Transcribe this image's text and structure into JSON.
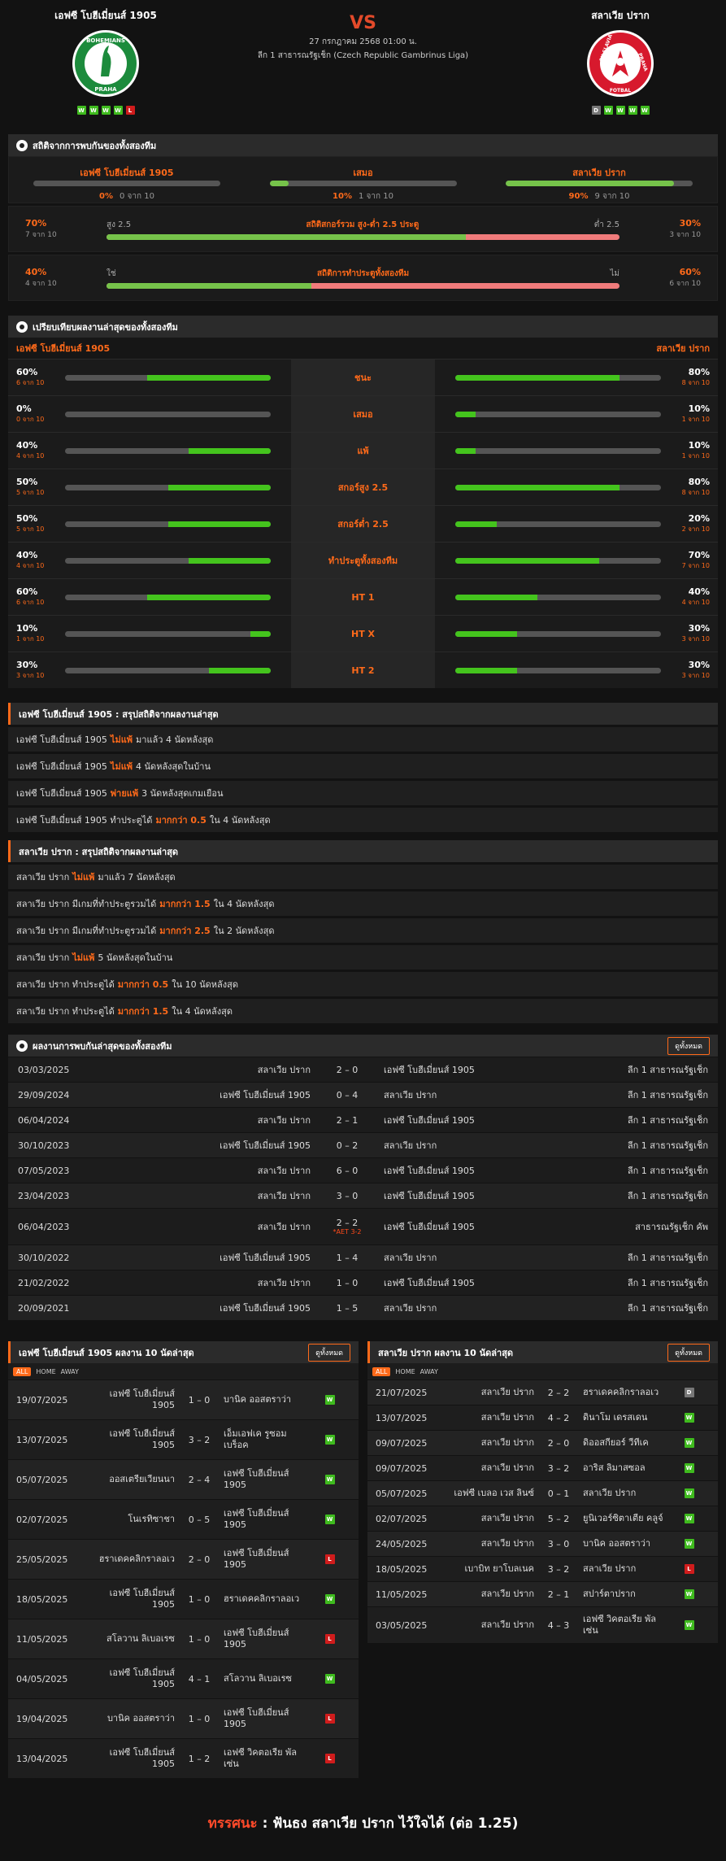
{
  "header": {
    "home": {
      "name": "เอฟซี โบฮีเมี่ยนส์ 1905",
      "form": [
        "W",
        "W",
        "W",
        "W",
        "L"
      ]
    },
    "away": {
      "name": "สลาเวีย ปราก",
      "form": [
        "D",
        "W",
        "W",
        "W",
        "W"
      ]
    },
    "vs": "VS",
    "date": "27 กรกฎาคม 2568 01:00 น.",
    "league": "ลีก 1 สาธารณรัฐเช็ก (Czech Republic Gambrinus Liga)",
    "home_logo_text": [
      "BOHEMIANS",
      "PRAHA"
    ],
    "away_logo_text": [
      "SK SLAVIA",
      "PRAHA",
      "FOTBAL"
    ]
  },
  "h2h_stats": {
    "title": "สถิติจากการพบกันของทั้งสองทีม",
    "cols": [
      {
        "label": "เอฟซี โบฮีเมี่ยนส์ 1905",
        "pct": "0%",
        "of": "0 จาก 10",
        "fill": 0
      },
      {
        "label": "เสมอ",
        "pct": "10%",
        "of": "1 จาก 10",
        "fill": 10
      },
      {
        "label": "สลาเวีย ปราก",
        "pct": "90%",
        "of": "9 จาก 10",
        "fill": 90
      }
    ],
    "ou": {
      "left_pct": "70%",
      "left_of": "7 จาก 10",
      "left_label": "สูง 2.5",
      "title": "สถิติสกอร์รวม สูง-ต่ำ 2.5 ประตู",
      "right_label": "ต่ำ 2.5",
      "right_pct": "30%",
      "right_of": "3 จาก 10",
      "fill": 70
    },
    "btts": {
      "left_pct": "40%",
      "left_of": "4 จาก 10",
      "left_label": "ใช่",
      "title": "สถิติการทำประตูทั้งสองทีม",
      "right_label": "ไม่",
      "right_pct": "60%",
      "right_of": "6 จาก 10",
      "fill": 40
    }
  },
  "compare": {
    "title": "เปรียบเทียบผลงานล่าสุดของทั้งสองทีม",
    "home": "เอฟซี โบฮีเมี่ยนส์ 1905",
    "away": "สลาเวีย ปราก",
    "rows": [
      {
        "label": "ชนะ",
        "hp": "60%",
        "ho": "6 จาก 10",
        "hv": 60,
        "ap": "80%",
        "ao": "8 จาก 10",
        "av": 80
      },
      {
        "label": "เสมอ",
        "hp": "0%",
        "ho": "0 จาก 10",
        "hv": 0,
        "ap": "10%",
        "ao": "1 จาก 10",
        "av": 10
      },
      {
        "label": "แพ้",
        "hp": "40%",
        "ho": "4 จาก 10",
        "hv": 40,
        "ap": "10%",
        "ao": "1 จาก 10",
        "av": 10
      },
      {
        "label": "สกอร์สูง 2.5",
        "hp": "50%",
        "ho": "5 จาก 10",
        "hv": 50,
        "ap": "80%",
        "ao": "8 จาก 10",
        "av": 80
      },
      {
        "label": "สกอร์ต่ำ 2.5",
        "hp": "50%",
        "ho": "5 จาก 10",
        "hv": 50,
        "ap": "20%",
        "ao": "2 จาก 10",
        "av": 20
      },
      {
        "label": "ทำประตูทั้งสองทีม",
        "hp": "40%",
        "ho": "4 จาก 10",
        "hv": 40,
        "ap": "70%",
        "ao": "7 จาก 10",
        "av": 70
      },
      {
        "label": "HT 1",
        "hp": "60%",
        "ho": "6 จาก 10",
        "hv": 60,
        "ap": "40%",
        "ao": "4 จาก 10",
        "av": 40
      },
      {
        "label": "HT X",
        "hp": "10%",
        "ho": "1 จาก 10",
        "hv": 10,
        "ap": "30%",
        "ao": "3 จาก 10",
        "av": 30
      },
      {
        "label": "HT 2",
        "hp": "30%",
        "ho": "3 จาก 10",
        "hv": 30,
        "ap": "30%",
        "ao": "3 จาก 10",
        "av": 30
      }
    ]
  },
  "home_summary": {
    "title": "เอฟซี โบฮีเมี่ยนส์ 1905 : สรุปสถิติจากผลงานล่าสุด",
    "rows": [
      [
        "เอฟซี โบฮีเมี่ยนส์ 1905",
        "ไม่แพ้",
        "มาแล้ว 4 นัดหลังสุด"
      ],
      [
        "เอฟซี โบฮีเมี่ยนส์ 1905",
        "ไม่แพ้",
        "4 นัดหลังสุดในบ้าน"
      ],
      [
        "เอฟซี โบฮีเมี่ยนส์ 1905",
        "พ่ายแพ้",
        "3 นัดหลังสุดเกมเยือน"
      ],
      [
        "เอฟซี โบฮีเมี่ยนส์ 1905 ทำประตูได้",
        "มากกว่า 0.5",
        "ใน 4 นัดหลังสุด"
      ]
    ]
  },
  "away_summary": {
    "title": "สลาเวีย ปราก : สรุปสถิติจากผลงานล่าสุด",
    "rows": [
      [
        "สลาเวีย ปราก",
        "ไม่แพ้",
        "มาแล้ว 7 นัดหลังสุด"
      ],
      [
        "สลาเวีย ปราก มีเกมที่ทำประตูรวมได้",
        "มากกว่า 1.5",
        "ใน 4 นัดหลังสุด"
      ],
      [
        "สลาเวีย ปราก มีเกมที่ทำประตูรวมได้",
        "มากกว่า 2.5",
        "ใน 2 นัดหลังสุด"
      ],
      [
        "สลาเวีย ปราก",
        "ไม่แพ้",
        "5 นัดหลังสุดในบ้าน"
      ],
      [
        "สลาเวีย ปราก ทำประตูได้",
        "มากกว่า 0.5",
        "ใน 10 นัดหลังสุด"
      ],
      [
        "สลาเวีย ปราก ทำประตูได้",
        "มากกว่า 1.5",
        "ใน 4 นัดหลังสุด"
      ]
    ]
  },
  "h2h_list": {
    "title": "ผลงานการพบกันล่าสุดของทั้งสองทีม",
    "button": "ดูทั้งหมด",
    "rows": [
      {
        "d": "03/03/2025",
        "h": "สลาเวีย ปราก",
        "s": "2 – 0",
        "a": "เอฟซี โบฮีเมี่ยนส์ 1905",
        "l": "ลีก 1 สาธารณรัฐเช็ก",
        "n": ""
      },
      {
        "d": "29/09/2024",
        "h": "เอฟซี โบฮีเมี่ยนส์ 1905",
        "s": "0 – 4",
        "a": "สลาเวีย ปราก",
        "l": "ลีก 1 สาธารณรัฐเช็ก",
        "n": ""
      },
      {
        "d": "06/04/2024",
        "h": "สลาเวีย ปราก",
        "s": "2 – 1",
        "a": "เอฟซี โบฮีเมี่ยนส์ 1905",
        "l": "ลีก 1 สาธารณรัฐเช็ก",
        "n": ""
      },
      {
        "d": "30/10/2023",
        "h": "เอฟซี โบฮีเมี่ยนส์ 1905",
        "s": "0 – 2",
        "a": "สลาเวีย ปราก",
        "l": "ลีก 1 สาธารณรัฐเช็ก",
        "n": ""
      },
      {
        "d": "07/05/2023",
        "h": "สลาเวีย ปราก",
        "s": "6 – 0",
        "a": "เอฟซี โบฮีเมี่ยนส์ 1905",
        "l": "ลีก 1 สาธารณรัฐเช็ก",
        "n": ""
      },
      {
        "d": "23/04/2023",
        "h": "สลาเวีย ปราก",
        "s": "3 – 0",
        "a": "เอฟซี โบฮีเมี่ยนส์ 1905",
        "l": "ลีก 1 สาธารณรัฐเช็ก",
        "n": ""
      },
      {
        "d": "06/04/2023",
        "h": "สลาเวีย ปราก",
        "s": "2 – 2",
        "a": "เอฟซี โบฮีเมี่ยนส์ 1905",
        "l": "สาธารณรัฐเช็ก คัพ",
        "n": "*AET 3-2"
      },
      {
        "d": "30/10/2022",
        "h": "เอฟซี โบฮีเมี่ยนส์ 1905",
        "s": "1 – 4",
        "a": "สลาเวีย ปราก",
        "l": "ลีก 1 สาธารณรัฐเช็ก",
        "n": ""
      },
      {
        "d": "21/02/2022",
        "h": "สลาเวีย ปราก",
        "s": "1 – 0",
        "a": "เอฟซี โบฮีเมี่ยนส์ 1905",
        "l": "ลีก 1 สาธารณรัฐเช็ก",
        "n": ""
      },
      {
        "d": "20/09/2021",
        "h": "เอฟซี โบฮีเมี่ยนส์ 1905",
        "s": "1 – 5",
        "a": "สลาเวีย ปราก",
        "l": "ลีก 1 สาธารณรัฐเช็ก",
        "n": ""
      }
    ]
  },
  "last10_home": {
    "title": "เอฟซี โบฮีเมี่ยนส์ 1905 ผลงาน 10 นัดล่าสุด",
    "button": "ดูทั้งหมด",
    "tabs": [
      "ALL",
      "HOME",
      "AWAY"
    ],
    "rows": [
      {
        "d": "19/07/2025",
        "h": "เอฟซี โบฮีเมี่ยนส์ 1905",
        "s": "1 – 0",
        "a": "บานิค ออสตราว่า",
        "r": "W"
      },
      {
        "d": "13/07/2025",
        "h": "เอฟซี โบฮีเมี่ยนส์ 1905",
        "s": "3 – 2",
        "a": "เอ็มเอฟเค รูซอมเบร็อค",
        "r": "W"
      },
      {
        "d": "05/07/2025",
        "h": "ออสเตรียเวียนนา",
        "s": "2 – 4",
        "a": "เอฟซี โบฮีเมี่ยนส์ 1905",
        "r": "W"
      },
      {
        "d": "02/07/2025",
        "h": "โนเรทิซาชา",
        "s": "0 – 5",
        "a": "เอฟซี โบฮีเมี่ยนส์ 1905",
        "r": "W"
      },
      {
        "d": "25/05/2025",
        "h": "ฮราเดคคลิกราลอเว",
        "s": "2 – 0",
        "a": "เอฟซี โบฮีเมี่ยนส์ 1905",
        "r": "L"
      },
      {
        "d": "18/05/2025",
        "h": "เอฟซี โบฮีเมี่ยนส์ 1905",
        "s": "1 – 0",
        "a": "ฮราเดคคลิกราลอเว",
        "r": "W"
      },
      {
        "d": "11/05/2025",
        "h": "สโลวาน ลิเบอเรซ",
        "s": "1 – 0",
        "a": "เอฟซี โบฮีเมี่ยนส์ 1905",
        "r": "L"
      },
      {
        "d": "04/05/2025",
        "h": "เอฟซี โบฮีเมี่ยนส์ 1905",
        "s": "4 – 1",
        "a": "สโลวาน ลิเบอเรซ",
        "r": "W"
      },
      {
        "d": "19/04/2025",
        "h": "บานิค ออสตราว่า",
        "s": "1 – 0",
        "a": "เอฟซี โบฮีเมี่ยนส์ 1905",
        "r": "L"
      },
      {
        "d": "13/04/2025",
        "h": "เอฟซี โบฮีเมี่ยนส์ 1905",
        "s": "1 – 2",
        "a": "เอฟซี วิคตอเรีย พัลเซ่น",
        "r": "L"
      }
    ]
  },
  "last10_away": {
    "title": "สลาเวีย ปราก ผลงาน 10 นัดล่าสุด",
    "button": "ดูทั้งหมด",
    "tabs": [
      "ALL",
      "HOME",
      "AWAY"
    ],
    "rows": [
      {
        "d": "21/07/2025",
        "h": "สลาเวีย ปราก",
        "s": "2 – 2",
        "a": "ฮราเดคคลิกราลอเว",
        "r": "D"
      },
      {
        "d": "13/07/2025",
        "h": "สลาเวีย ปราก",
        "s": "4 – 2",
        "a": "ดินาโม เดรสเดน",
        "r": "W"
      },
      {
        "d": "09/07/2025",
        "h": "สลาเวีย ปราก",
        "s": "2 – 0",
        "a": "ดิออสกียอร์ วีทีเค",
        "r": "W"
      },
      {
        "d": "09/07/2025",
        "h": "สลาเวีย ปราก",
        "s": "3 – 2",
        "a": "อาริส ลิมาสซอล",
        "r": "W"
      },
      {
        "d": "05/07/2025",
        "h": "เอฟซี เบลอ เวส ลินซ์",
        "s": "0 – 1",
        "a": "สลาเวีย ปราก",
        "r": "W"
      },
      {
        "d": "02/07/2025",
        "h": "สลาเวีย ปราก",
        "s": "5 – 2",
        "a": "ยูนิเวอร์ซิตาเตีย คลูจ์",
        "r": "W"
      },
      {
        "d": "24/05/2025",
        "h": "สลาเวีย ปราก",
        "s": "3 – 0",
        "a": "บานิค ออสตราว่า",
        "r": "W"
      },
      {
        "d": "18/05/2025",
        "h": "เบาบิท ยาโบลเนค",
        "s": "3 – 2",
        "a": "สลาเวีย ปราก",
        "r": "L"
      },
      {
        "d": "11/05/2025",
        "h": "สลาเวีย ปราก",
        "s": "2 – 1",
        "a": "สปาร์ตาปราก",
        "r": "W"
      },
      {
        "d": "03/05/2025",
        "h": "สลาเวีย ปราก",
        "s": "4 – 3",
        "a": "เอฟซี วิคตอเรีย พัลเซ่น",
        "r": "W"
      }
    ]
  },
  "verdict": {
    "label": "ทรรศนะ",
    "sep": ":",
    "text": "ฟันธง สลาเวีย ปราก ไว้ใจได้ (ต่อ 1.25)"
  }
}
